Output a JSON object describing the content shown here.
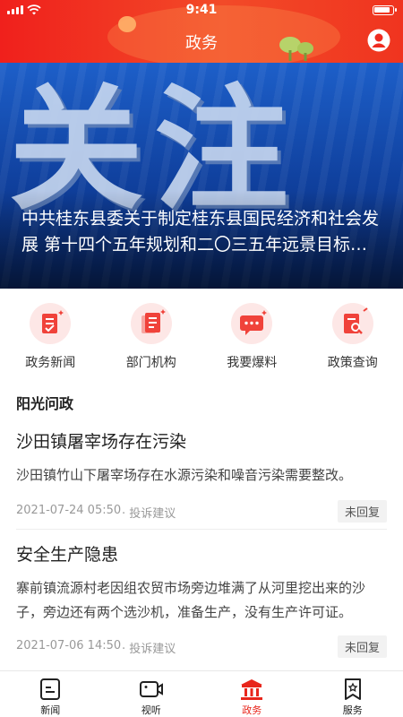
{
  "status_bar": {
    "time": "9:41"
  },
  "header": {
    "title": "政务"
  },
  "banner": {
    "image_text": "关注",
    "caption": "中共桂东县委关于制定桂东县国民经济和社会发展 第十四个五年规划和二〇三五年远景目标的建议",
    "slide_count": 5,
    "active_slide": 1
  },
  "quick_menu": [
    {
      "label": "政务新闻",
      "icon": "news-doc-icon"
    },
    {
      "label": "部门机构",
      "icon": "department-list-icon"
    },
    {
      "label": "我要爆料",
      "icon": "report-chat-icon"
    },
    {
      "label": "政策查询",
      "icon": "policy-search-icon"
    }
  ],
  "section": {
    "title": "阳光问政"
  },
  "posts": [
    {
      "title": "沙田镇屠宰场存在污染",
      "desc": "沙田镇竹山下屠宰场存在水源污染和噪音污染需要整改。",
      "date": "2021-07-24 05:50",
      "tag": "投诉建议",
      "status": "未回复"
    },
    {
      "title": "安全生产隐患",
      "desc": "寨前镇流源村老因组农贸市场旁边堆满了从河里挖出来的沙子，旁边还有两个选沙机，准备生产，没有生产许可证。",
      "date": "2021-07-06 14:50",
      "tag": "投诉建议",
      "status": "未回复"
    }
  ],
  "tabbar": [
    {
      "label": "新闻",
      "icon": "news-icon",
      "active": false
    },
    {
      "label": "视听",
      "icon": "video-icon",
      "active": false
    },
    {
      "label": "政务",
      "icon": "government-building-icon",
      "active": true
    },
    {
      "label": "服务",
      "icon": "service-bookmark-icon",
      "active": false
    }
  ],
  "colors": {
    "brand_red": "#e8261c",
    "banner_blue": "#0f3f9c"
  }
}
